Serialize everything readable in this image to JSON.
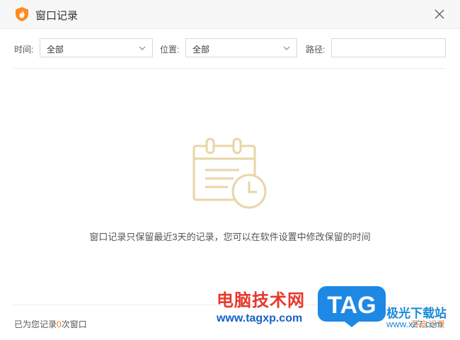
{
  "window": {
    "title": "窗口记录"
  },
  "filters": {
    "time_label": "时间:",
    "time_value": "全部",
    "location_label": "位置:",
    "location_value": "全部",
    "path_label": "路径:",
    "path_value": ""
  },
  "empty_state": {
    "message": "窗口记录只保留最近3天的记录，您可以在软件设置中修改保留的时间"
  },
  "footer": {
    "status_prefix": "已为您记录",
    "count": "0",
    "status_suffix": "次窗口",
    "open_link": "开启记录"
  },
  "watermark": {
    "site_name": "电脑技术网",
    "site_url": "www.tagxp.com",
    "badge": "TAG",
    "right_name": "极光下载站",
    "right_url": "www.xz7.com"
  },
  "colors": {
    "accent": "#ff7a1a",
    "illustration": "#e8d5a8",
    "watermark_red": "#e8372b",
    "watermark_blue": "#1a5fc7",
    "badge_blue": "#1e88e5"
  }
}
